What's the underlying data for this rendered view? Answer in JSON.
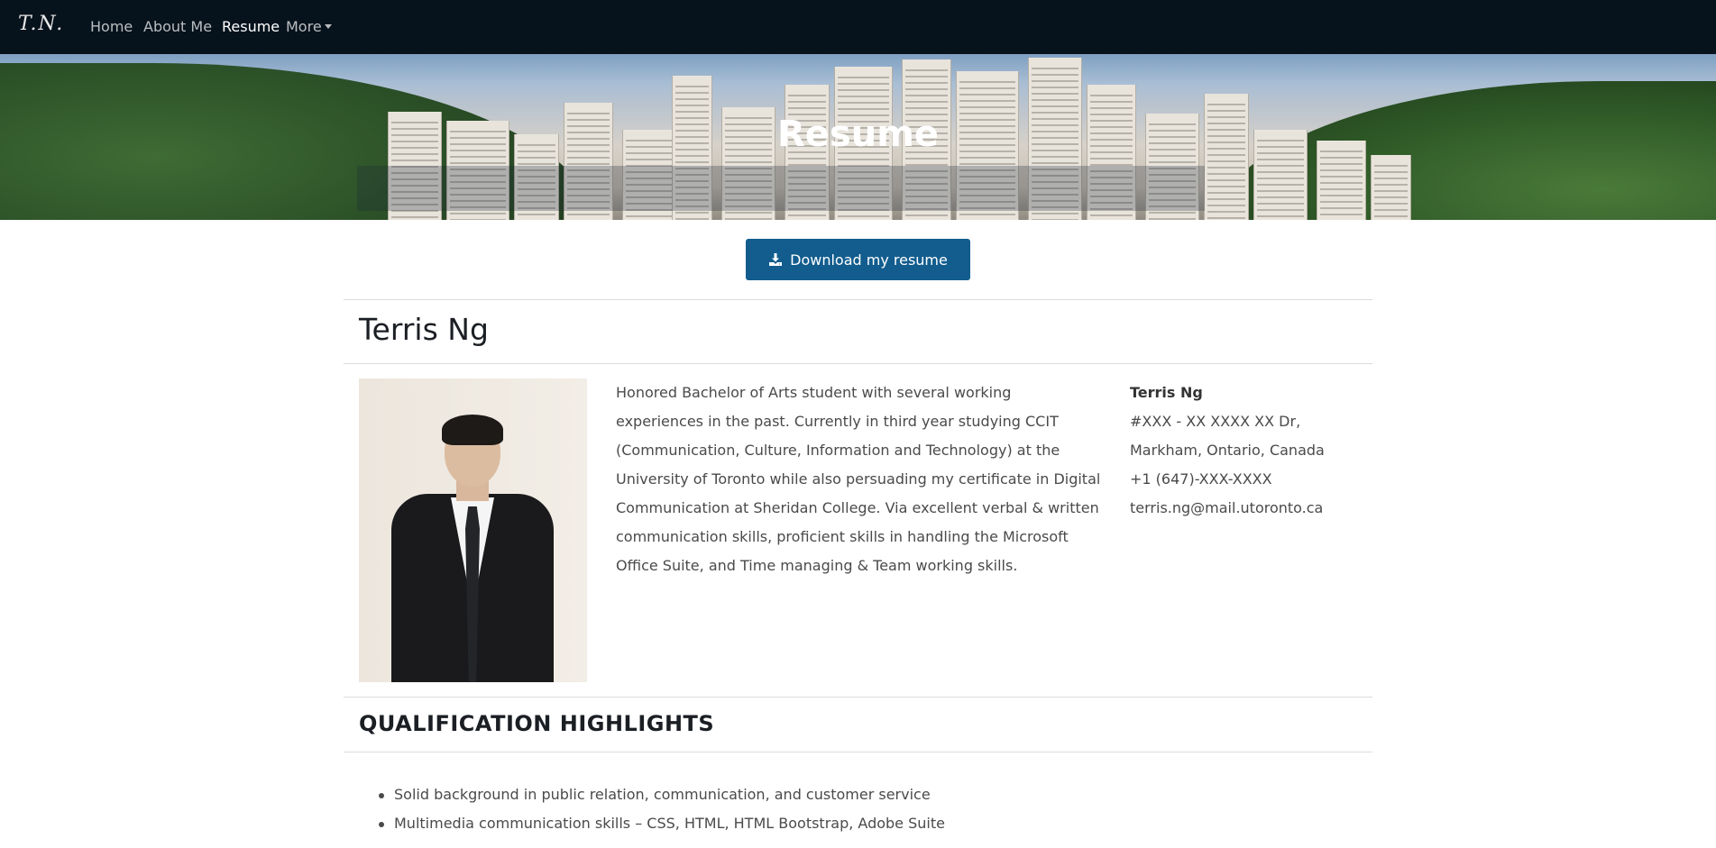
{
  "nav": {
    "brand": "T.N.",
    "items": [
      {
        "label": "Home"
      },
      {
        "label": "About Me"
      },
      {
        "label": "Resume"
      },
      {
        "label": "More"
      }
    ]
  },
  "hero": {
    "title": "Resume"
  },
  "download_label": "Download my resume",
  "profile": {
    "name": "Terris Ng",
    "bio": "Honored Bachelor of Arts student with several working experiences in the past. Currently in third year studying CCIT (Communication, Culture, Information and Technology) at the University of Toronto while also persuading my certificate in Digital Communication at Sheridan College. Via excellent verbal & written communication skills, proficient skills in handling the Microsoft Office Suite, and Time managing & Team working skills.",
    "contact": {
      "name": "Terris Ng",
      "address_line1": "#XXX - XX XXXX XX Dr,",
      "address_line2": "Markham, Ontario, Canada",
      "phone": "+1 (647)-XXX-XXXX",
      "email": "terris.ng@mail.utoronto.ca"
    }
  },
  "qualifications": {
    "title": "QUALIFICATION HIGHLIGHTS",
    "items": [
      "Solid background in public relation, communication, and customer service",
      "Multimedia communication skills – CSS, HTML, HTML Bootstrap, Adobe Suite"
    ]
  }
}
